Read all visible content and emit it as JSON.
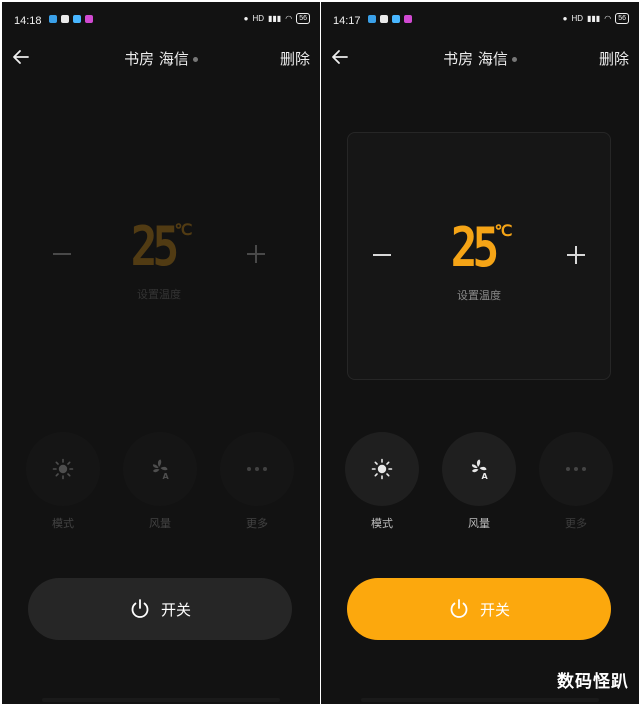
{
  "panels": [
    {
      "status": {
        "time": "14:18",
        "battery": "56"
      },
      "header": {
        "title": "书房 海信",
        "delete_label": "删除"
      },
      "temperature": {
        "value": "25",
        "unit": "℃",
        "label": "设置温度"
      },
      "controls": [
        {
          "label": "模式",
          "icon": "sun-icon"
        },
        {
          "label": "风量",
          "icon": "fan-auto-icon"
        },
        {
          "label": "更多",
          "icon": "more-icon"
        }
      ],
      "power": {
        "label": "开关",
        "icon": "power-icon"
      }
    },
    {
      "status": {
        "time": "14:17",
        "battery": "56"
      },
      "header": {
        "title": "书房 海信",
        "delete_label": "删除"
      },
      "temperature": {
        "value": "25",
        "unit": "℃",
        "label": "设置温度"
      },
      "controls": [
        {
          "label": "模式",
          "icon": "sun-icon"
        },
        {
          "label": "风量",
          "icon": "fan-auto-icon"
        },
        {
          "label": "更多",
          "icon": "more-icon"
        }
      ],
      "power": {
        "label": "开关",
        "icon": "power-icon"
      }
    }
  ],
  "watermark": "数码怪趴",
  "colors": {
    "accent": "#fca80d",
    "background": "#121212",
    "temperature": "#f5a416"
  }
}
